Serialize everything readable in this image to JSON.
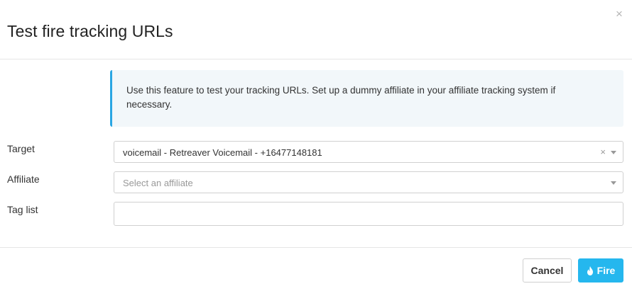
{
  "dialog": {
    "title": "Test fire tracking URLs",
    "close_icon": "close-icon"
  },
  "info": {
    "message": "Use this feature to test your tracking URLs. Set up a dummy affiliate in your affiliate tracking system if necessary.",
    "accent_color": "#2aa6e3"
  },
  "form": {
    "target": {
      "label": "Target",
      "value": "voicemail - Retreaver Voicemail - +16477148181"
    },
    "affiliate": {
      "label": "Affiliate",
      "placeholder": "Select an affiliate"
    },
    "tag_list": {
      "label": "Tag list",
      "value": ""
    }
  },
  "footer": {
    "cancel_label": "Cancel",
    "fire_label": "Fire",
    "fire_icon": "flame-icon",
    "fire_color": "#25b7ee"
  }
}
